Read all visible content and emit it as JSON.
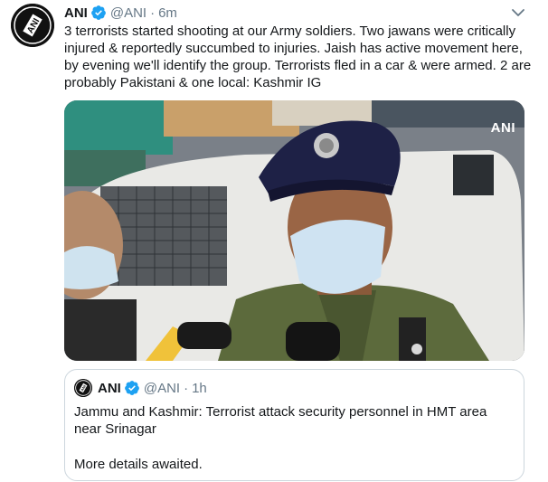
{
  "tweet": {
    "author_name": "ANI",
    "handle": "@ANI",
    "separator": "·",
    "time": "6m",
    "avatar_text": "ANI",
    "text": "3 terrorists started shooting at our Army soldiers. Two jawans were critically injured & reportedly succumbed to injuries. Jaish has active movement here, by evening we'll identify the group. Terrorists fled in a car & were armed. 2 are probably Pakistani & one local: Kashmir IG",
    "media_watermark": "ANI",
    "verified_color": "#1da1f2"
  },
  "quote": {
    "author_name": "ANI",
    "handle": "@ANI",
    "separator": "·",
    "time": "1h",
    "avatar_text": "ANI",
    "text": "Jammu and Kashmir: Terrorist attack security personnel in HMT area near Srinagar",
    "more_text": "More details awaited."
  }
}
